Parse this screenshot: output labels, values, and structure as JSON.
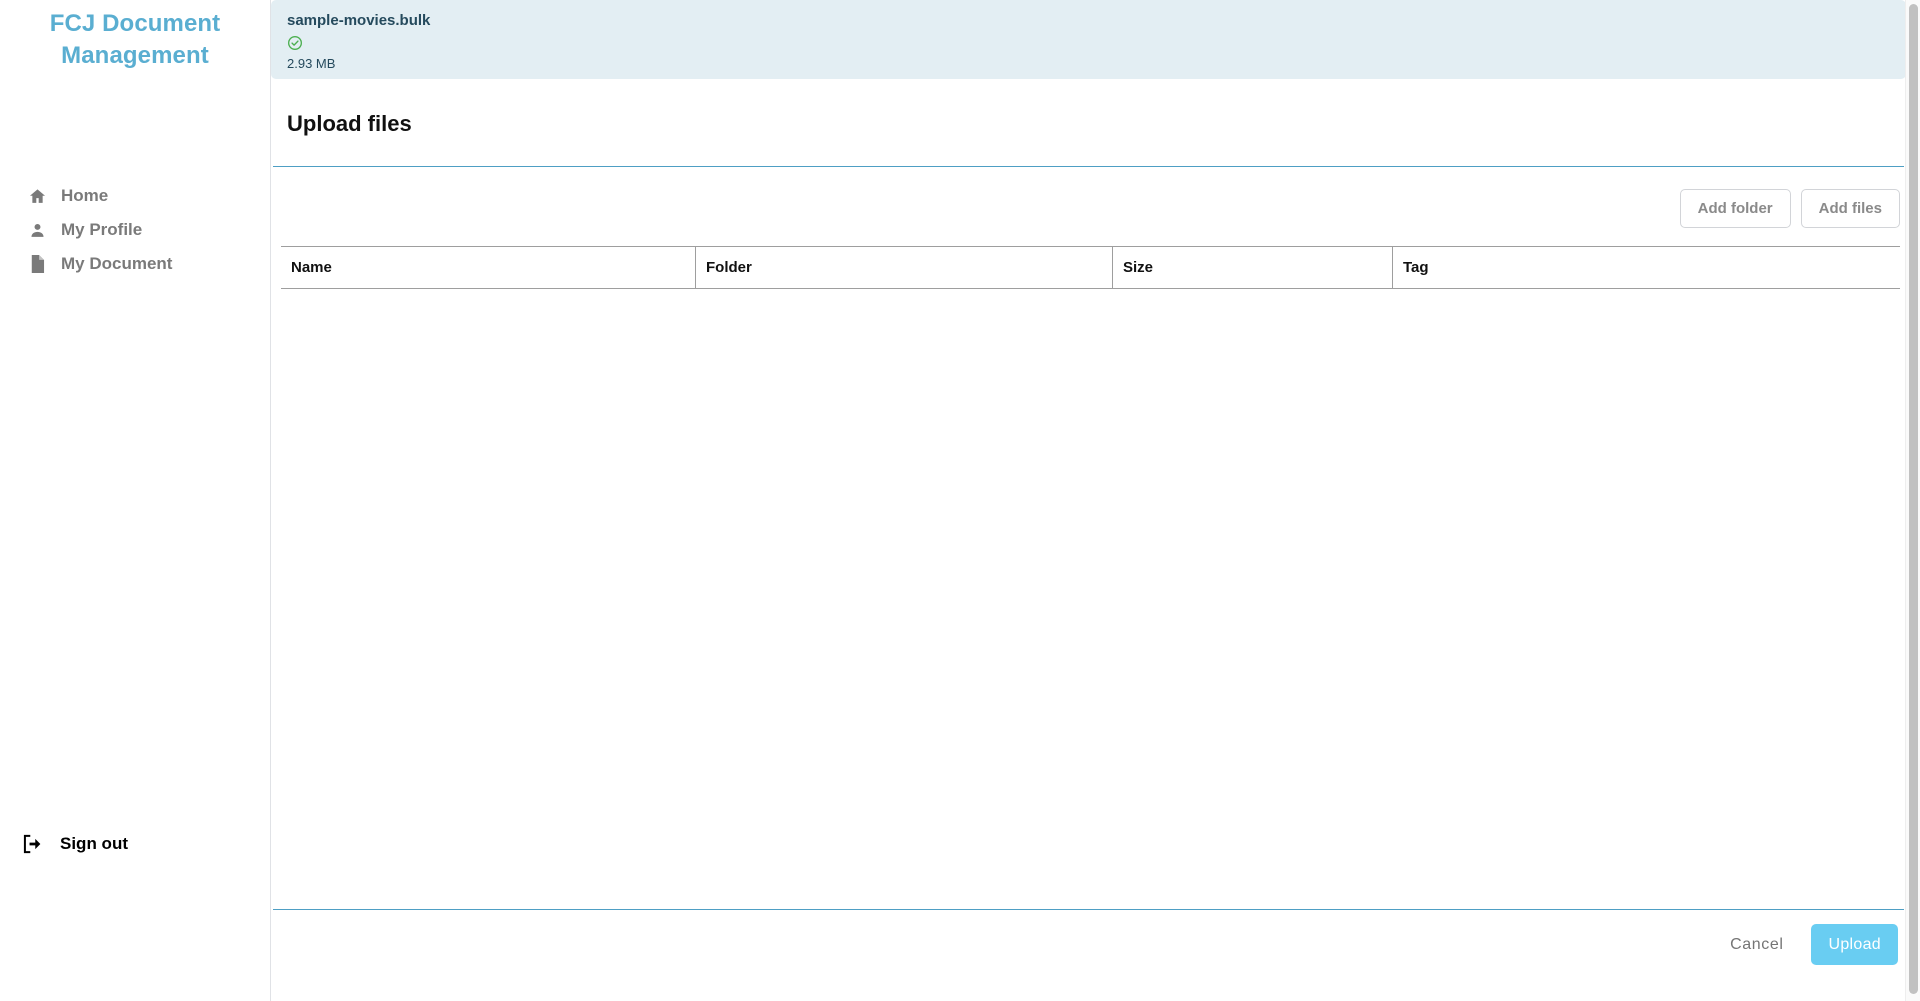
{
  "sidebar": {
    "brand": "FCJ Document Management",
    "items": [
      {
        "label": "Home",
        "icon": "home-icon"
      },
      {
        "label": "My Profile",
        "icon": "person-icon"
      },
      {
        "label": "My Document",
        "icon": "document-icon"
      }
    ],
    "signout": {
      "label": "Sign out",
      "icon": "sign-out-icon"
    }
  },
  "notification": {
    "file_name": "sample-movies.bulk",
    "status_icon": "check-circle-icon",
    "status_color": "#4caf50",
    "file_size": "2.93 MB",
    "background": "#e3eef3",
    "text_color": "#254a5d"
  },
  "panel": {
    "title": "Upload files",
    "accent_color": "#4e9fc4"
  },
  "toolbar": {
    "add_folder_label": "Add folder",
    "add_files_label": "Add files"
  },
  "table": {
    "columns": [
      "Name",
      "Folder",
      "Size",
      "Tag"
    ],
    "rows": []
  },
  "footer": {
    "cancel_label": "Cancel",
    "upload_label": "Upload",
    "upload_color": "#69cdf2"
  }
}
